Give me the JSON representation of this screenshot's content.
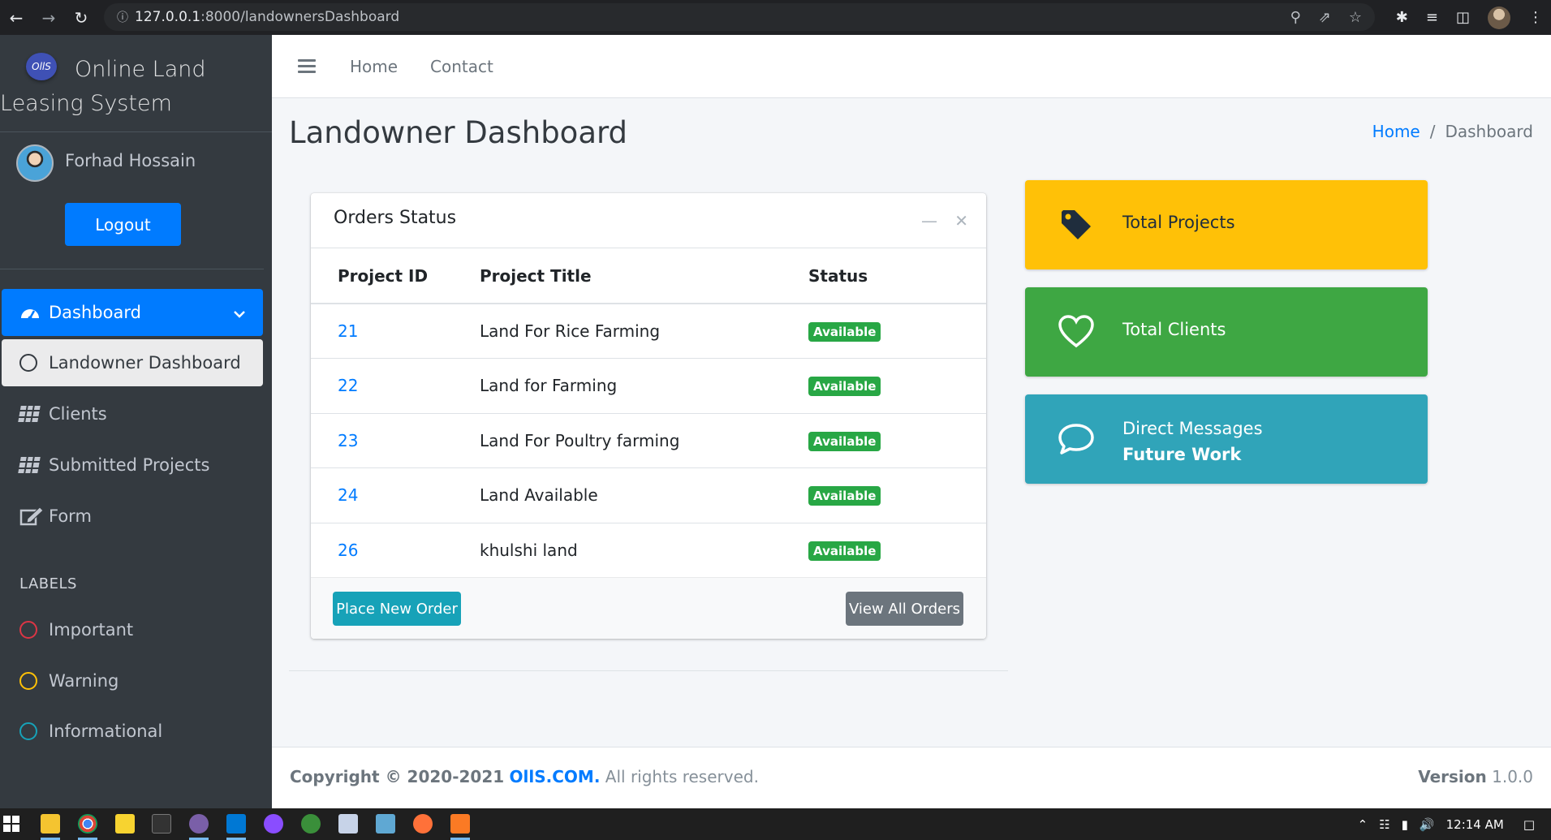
{
  "browser": {
    "url_host": "127.0.0.1",
    "url_path": ":8000/landownersDashboard"
  },
  "brand": {
    "logo_text": "OllS",
    "name": "Online Land Leasing System"
  },
  "user": {
    "name": "Forhad Hossain",
    "logout_label": "Logout"
  },
  "sidebar": {
    "items": [
      {
        "label": "Dashboard"
      },
      {
        "label": "Landowner Dashboard"
      },
      {
        "label": "Clients"
      },
      {
        "label": "Submitted Projects"
      },
      {
        "label": "Form"
      }
    ],
    "labels_header": "LABELS",
    "labels": [
      {
        "label": "Important",
        "color": "#dc3545"
      },
      {
        "label": "Warning",
        "color": "#ffc107"
      },
      {
        "label": "Informational",
        "color": "#17a2b8"
      }
    ]
  },
  "topnav": {
    "home": "Home",
    "contact": "Contact"
  },
  "page": {
    "title": "Landowner Dashboard",
    "breadcrumb": [
      "Home",
      "/",
      "Dashboard"
    ]
  },
  "orders": {
    "title": "Orders Status",
    "columns": [
      "Project ID",
      "Project Title",
      "Status"
    ],
    "rows": [
      {
        "id": "21",
        "title": "Land For Rice Farming",
        "status": "Available"
      },
      {
        "id": "22",
        "title": "Land for Farming",
        "status": "Available"
      },
      {
        "id": "23",
        "title": "Land For Poultry farming",
        "status": "Available"
      },
      {
        "id": "24",
        "title": "Land Available",
        "status": "Available"
      },
      {
        "id": "26",
        "title": "khulshi land",
        "status": "Available"
      }
    ],
    "place_order": "Place New Order",
    "view_all": "View All Orders"
  },
  "info_boxes": {
    "projects": {
      "label": "Total Projects",
      "color": "#ffc107",
      "icon": "tag-icon"
    },
    "clients": {
      "label": "Total Clients",
      "color": "#3ea743",
      "icon": "heart-icon"
    },
    "messages": {
      "label": "Direct Messages",
      "sub": "Future Work",
      "color": "#30a4b9",
      "icon": "comment-icon"
    }
  },
  "footer": {
    "copy_prefix": "Copyright © 2020-2021",
    "copy_brand": "OllS.COM.",
    "copy_suffix": "All rights reserved.",
    "version_label": "Version",
    "version": "1.0.0"
  },
  "taskbar": {
    "time": "12:14 AM"
  }
}
